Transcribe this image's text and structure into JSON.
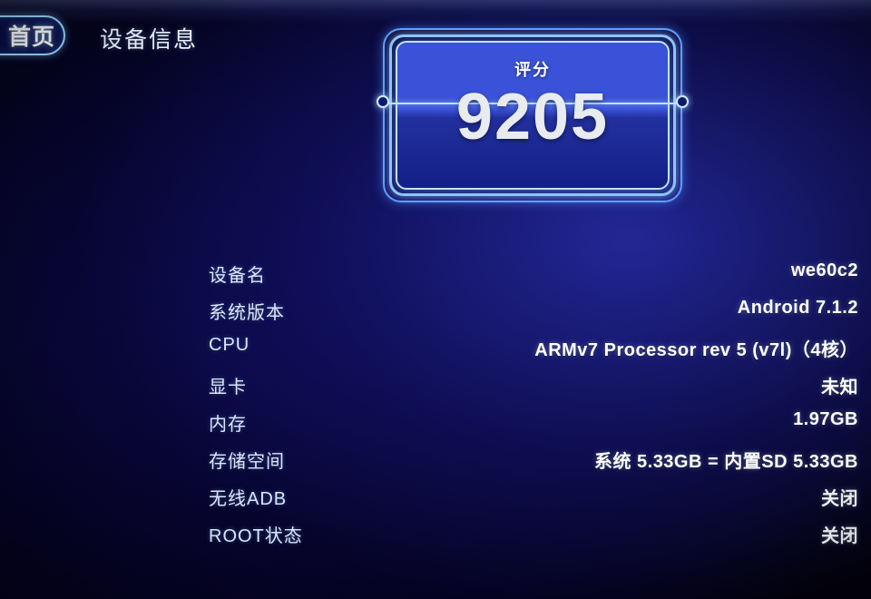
{
  "topbar": {
    "home_button_label": "首页",
    "page_title": "设备信息"
  },
  "score_card": {
    "label": "评分",
    "value": "9205"
  },
  "info": {
    "rows": [
      {
        "label": "设备名",
        "value": "we60c2"
      },
      {
        "label": "系统版本",
        "value": "Android 7.1.2"
      },
      {
        "label": "CPU",
        "value": "ARMv7 Processor rev 5 (v7l)（4核）"
      },
      {
        "label": "显卡",
        "value": "未知"
      },
      {
        "label": "内存",
        "value": "1.97GB"
      },
      {
        "label": "存储空间",
        "value": "系统 5.33GB = 内置SD 5.33GB"
      },
      {
        "label": "无线ADB",
        "value": "关闭"
      },
      {
        "label": "ROOT状态",
        "value": "关闭"
      }
    ]
  },
  "colors": {
    "background_deep": "#07003a",
    "background_glow": "#2a2dae",
    "accent_border": "#9fdcff",
    "card_top": "#3a52d8",
    "card_bottom": "#141f87",
    "label_text": "#dbe6ff",
    "value_text": "#ffffff"
  }
}
